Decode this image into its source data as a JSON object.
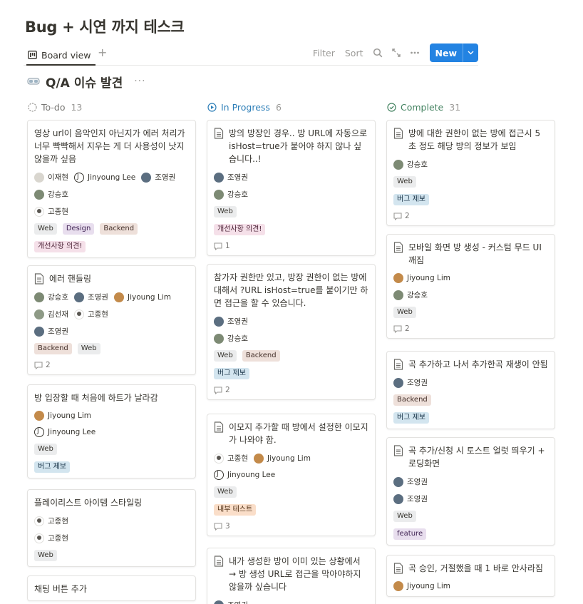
{
  "page": {
    "title": "Bug + 시연 까지 테스크"
  },
  "toolbar": {
    "view_label": "Board view",
    "add_view": "+",
    "filter": "Filter",
    "sort": "Sort",
    "new_label": "New"
  },
  "group": {
    "title": "Q/A 이슈 발견",
    "more": "···"
  },
  "columns": [
    {
      "name": "To-do",
      "count": "13",
      "color": "#9b9a97"
    },
    {
      "name": "In Progress",
      "count": "6",
      "color": "#2e7fb8"
    },
    {
      "name": "Complete",
      "count": "31",
      "color": "#448361"
    }
  ],
  "todo": [
    {
      "title": "영상 url이 음악인지 아닌지가 에러 처리가 너무 빡빡해서 지우는 게 더 사용성이 낫지 않을까 싶음",
      "people1": [
        "이재현",
        "Jinyoung Lee",
        "조영권"
      ],
      "people2": [
        "강승호"
      ],
      "people3": [
        "고종현"
      ],
      "tags1": [
        "Web",
        "Design",
        "Backend"
      ],
      "tags2": [
        "개선사항 의견!"
      ]
    },
    {
      "title": "에러 핸들링",
      "people1": [
        "강승호",
        "조영권",
        "Jiyoung Lim"
      ],
      "people2": [
        "김선재",
        "고종현"
      ],
      "people3": [
        "조영권"
      ],
      "tags1": [
        "Backend",
        "Web"
      ],
      "comments": "2"
    },
    {
      "title": "방 입장할 때 처음에 하트가 날라감",
      "people1": [
        "Jiyoung Lim"
      ],
      "people2": [
        "Jinyoung Lee"
      ],
      "tags1": [
        "Web"
      ],
      "tags2": [
        "버그 제보"
      ]
    },
    {
      "title": "플레이리스트 아이템 스타일링",
      "people1": [
        "고종현"
      ],
      "people2": [
        "고종현"
      ],
      "tags1": [
        "Web"
      ]
    },
    {
      "title": "채팅 버튼 추가"
    }
  ],
  "progress": [
    {
      "title": "방의 방장인 경우.. 방 URL에 자동으로 isHost=true가 붙어야 하지 않나 싶습니다..!",
      "people1": [
        "조영권"
      ],
      "people2": [
        "강승호"
      ],
      "tags1": [
        "Web"
      ],
      "tags2": [
        "개선사항 의견!"
      ],
      "comments": "1"
    },
    {
      "title": "참가자 권한만 있고, 방장 권한이 없는 방에 대해서 ?URL isHost=true를 붙이기만 하면 접근을 할 수 있습니다.",
      "people1": [
        "조영권"
      ],
      "people2": [
        "강승호"
      ],
      "tags1": [
        "Web",
        "Backend"
      ],
      "tags2": [
        "버그 제보"
      ],
      "comments": "2"
    },
    {
      "title": "이모지 추가할 때 방에서 설정한 이모지가 나와야 함.",
      "people1": [
        "고종현",
        "Jiyoung Lim"
      ],
      "people2": [
        "Jinyoung Lee"
      ],
      "tags1": [
        "Web"
      ],
      "tags2": [
        "내부 테스트"
      ],
      "comments": "3"
    },
    {
      "title": "내가 생성한 방이 이미 있는 상황에서 → 방 생성 URL로 접근을 막아야하지 않을까 싶습니다",
      "people1": [
        "조영권"
      ]
    }
  ],
  "complete": [
    {
      "title": "방에 대한 권한이 없는 방에 접근시 5초 정도 해당 방의 정보가 보임",
      "people1": [
        "강승호"
      ],
      "tags1": [
        "Web"
      ],
      "tags2": [
        "버그 제보"
      ],
      "comments": "2"
    },
    {
      "title": "모바일 화면 방 생성 - 커스텀 무드 UI 깨짐",
      "people1": [
        "Jiyoung Lim"
      ],
      "people2": [
        "강승호"
      ],
      "tags1": [
        "Web"
      ],
      "comments": "2"
    },
    {
      "title": "곡 추가하고 나서 추가한곡 재생이 안됨",
      "people1": [
        "조영권"
      ],
      "tags1": [
        "Backend"
      ],
      "tags2": [
        "버그 제보"
      ]
    },
    {
      "title": "곡 추가/신청 시 토스트 얼럿 띄우기 + 로딩화면",
      "people1": [
        "조영권"
      ],
      "people2": [
        "조영권"
      ],
      "tags1": [
        "Web"
      ],
      "tags2": [
        "feature"
      ]
    },
    {
      "title": "곡 승인, 거절했을 때 1 바로 안사라짐",
      "people1": [
        "Jiyoung Lim"
      ]
    }
  ]
}
